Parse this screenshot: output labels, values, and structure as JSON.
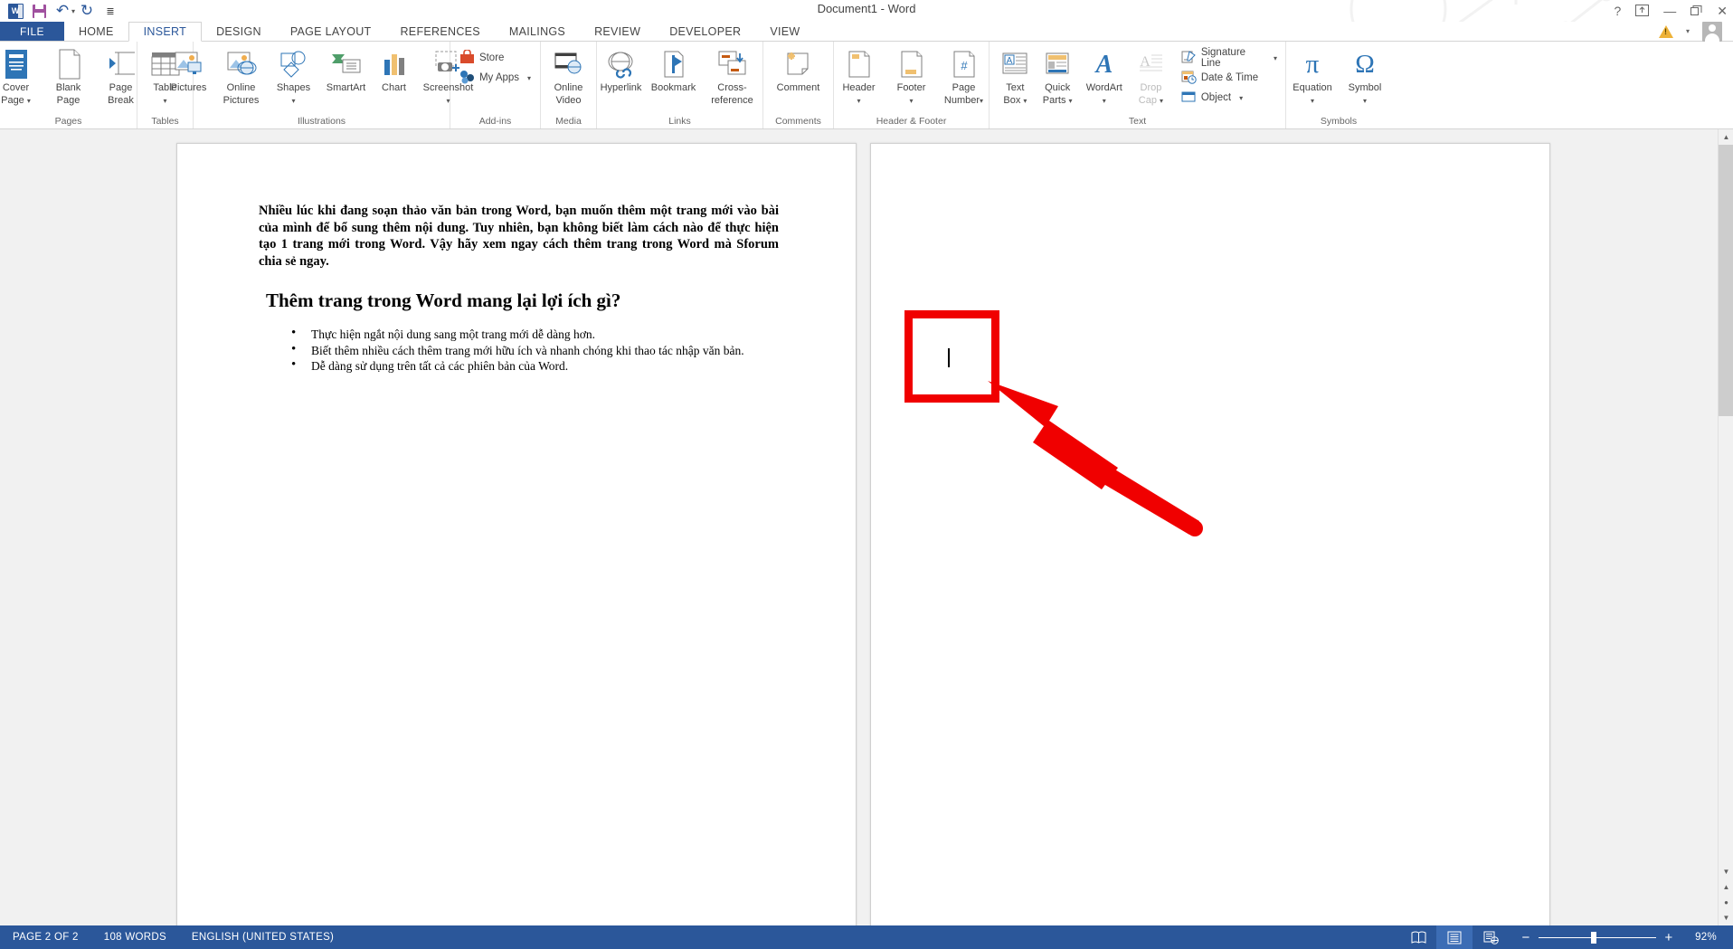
{
  "titlebar": {
    "document_title": "Document1 - Word",
    "qat": [
      {
        "name": "word-logo",
        "label": "W"
      },
      {
        "name": "save",
        "label": "Save"
      },
      {
        "name": "undo",
        "label": "Undo"
      },
      {
        "name": "redo",
        "label": "Repeat"
      },
      {
        "name": "customize",
        "label": "Customize Quick Access Toolbar"
      }
    ],
    "window_controls": {
      "help": "?",
      "ribbon_display": "Ribbon Display Options",
      "minimize": "—",
      "restore": "❐",
      "close": "✕"
    },
    "account": {
      "warning": "!",
      "dropdown": "▾",
      "avatar": "Account"
    }
  },
  "tabs": [
    {
      "label": "FILE",
      "active": false,
      "file": true
    },
    {
      "label": "HOME",
      "active": false
    },
    {
      "label": "INSERT",
      "active": true
    },
    {
      "label": "DESIGN",
      "active": false
    },
    {
      "label": "PAGE LAYOUT",
      "active": false
    },
    {
      "label": "REFERENCES",
      "active": false
    },
    {
      "label": "MAILINGS",
      "active": false
    },
    {
      "label": "REVIEW",
      "active": false
    },
    {
      "label": "DEVELOPER",
      "active": false
    },
    {
      "label": "VIEW",
      "active": false
    }
  ],
  "ribbon": {
    "groups": [
      {
        "label": "Pages",
        "buttons": [
          {
            "label": "Cover\nPage",
            "line1": "Cover",
            "line2": "Page",
            "caret": true,
            "icon": "cover-page-icon"
          },
          {
            "label": "Blank\nPage",
            "line1": "Blank",
            "line2": "Page",
            "caret": false,
            "icon": "blank-page-icon"
          },
          {
            "label": "Page\nBreak",
            "line1": "Page",
            "line2": "Break",
            "caret": false,
            "icon": "page-break-icon"
          }
        ]
      },
      {
        "label": "Tables",
        "buttons": [
          {
            "line1": "Table",
            "line2": "",
            "caret": true,
            "icon": "table-icon"
          }
        ]
      },
      {
        "label": "Illustrations",
        "buttons": [
          {
            "line1": "Pictures",
            "line2": "",
            "caret": false,
            "icon": "pictures-icon"
          },
          {
            "line1": "Online",
            "line2": "Pictures",
            "caret": false,
            "icon": "online-pictures-icon"
          },
          {
            "line1": "Shapes",
            "line2": "",
            "caret": true,
            "icon": "shapes-icon"
          },
          {
            "line1": "SmartArt",
            "line2": "",
            "caret": false,
            "icon": "smartart-icon"
          },
          {
            "line1": "Chart",
            "line2": "",
            "caret": false,
            "icon": "chart-icon"
          },
          {
            "line1": "Screenshot",
            "line2": "",
            "caret": true,
            "icon": "screenshot-icon"
          }
        ]
      },
      {
        "label": "Add-ins",
        "small_buttons": [
          {
            "label": "Store",
            "icon": "store-icon",
            "caret": false
          },
          {
            "label": "My Apps",
            "icon": "my-apps-icon",
            "caret": true
          }
        ]
      },
      {
        "label": "Media",
        "buttons": [
          {
            "line1": "Online",
            "line2": "Video",
            "caret": false,
            "icon": "online-video-icon"
          }
        ]
      },
      {
        "label": "Links",
        "buttons": [
          {
            "line1": "Hyperlink",
            "line2": "",
            "caret": false,
            "icon": "hyperlink-icon"
          },
          {
            "line1": "Bookmark",
            "line2": "",
            "caret": false,
            "icon": "bookmark-icon"
          },
          {
            "line1": "Cross-",
            "line2": "reference",
            "caret": false,
            "icon": "cross-reference-icon"
          }
        ]
      },
      {
        "label": "Comments",
        "buttons": [
          {
            "line1": "Comment",
            "line2": "",
            "caret": false,
            "icon": "comment-icon"
          }
        ]
      },
      {
        "label": "Header & Footer",
        "buttons": [
          {
            "line1": "Header",
            "line2": "",
            "caret": true,
            "icon": "header-icon"
          },
          {
            "line1": "Footer",
            "line2": "",
            "caret": true,
            "icon": "footer-icon"
          },
          {
            "line1": "Page",
            "line2": "Number",
            "caret": true,
            "icon": "page-number-icon"
          }
        ]
      },
      {
        "label": "Text",
        "buttons": [
          {
            "line1": "Text",
            "line2": "Box",
            "caret": true,
            "icon": "text-box-icon"
          },
          {
            "line1": "Quick",
            "line2": "Parts",
            "caret": true,
            "icon": "quick-parts-icon"
          },
          {
            "line1": "WordArt",
            "line2": "",
            "caret": true,
            "icon": "wordart-icon"
          },
          {
            "line1": "Drop",
            "line2": "Cap",
            "caret": true,
            "icon": "drop-cap-icon",
            "disabled": true
          }
        ],
        "small_buttons": [
          {
            "label": "Signature Line",
            "icon": "signature-line-icon",
            "caret": true
          },
          {
            "label": "Date & Time",
            "icon": "date-time-icon",
            "caret": false
          },
          {
            "label": "Object",
            "icon": "object-icon",
            "caret": true
          }
        ]
      },
      {
        "label": "Symbols",
        "buttons": [
          {
            "line1": "Equation",
            "line2": "",
            "caret": true,
            "icon": "equation-icon",
            "glyph": "π"
          },
          {
            "line1": "Symbol",
            "line2": "",
            "caret": true,
            "icon": "symbol-icon",
            "glyph": "Ω"
          }
        ]
      }
    ]
  },
  "document": {
    "paragraph": "Nhiều lúc khi đang soạn thảo văn bản trong Word, bạn muốn thêm một trang mới vào bài của mình để bổ sung thêm nội dung. Tuy nhiên, bạn không biết làm cách nào để thực hiện tạo 1 trang mới trong Word. Vậy hãy xem ngay cách thêm trang trong Word mà Sforum chia sẻ ngay.",
    "heading": "Thêm trang trong Word mang lại lợi ích gì?",
    "bullets": [
      "Thực hiện ngắt nội dung sang một trang mới dễ dàng hơn.",
      "Biết thêm nhiều cách thêm trang mới hữu ích và nhanh chóng khi thao tác nhập văn bản.",
      "Dễ dàng sử dụng trên tất cả các phiên bản của Word."
    ],
    "annotation": {
      "box_color": "#f00000",
      "arrow_color": "#f00000",
      "cursor": "text-cursor"
    }
  },
  "statusbar": {
    "page": "PAGE 2 OF 2",
    "words": "108 WORDS",
    "language": "ENGLISH (UNITED STATES)",
    "proofing_icon": "proofing-errors-icon",
    "views": [
      {
        "name": "read-mode",
        "selected": false
      },
      {
        "name": "print-layout",
        "selected": true
      },
      {
        "name": "web-layout",
        "selected": false
      }
    ],
    "zoom": {
      "minus": "−",
      "plus": "+",
      "percent": "92%"
    }
  },
  "scrollbar": {
    "up": "▲",
    "down": "▼",
    "prev_page": "▲",
    "next_page": "▼",
    "select_object": "●"
  }
}
